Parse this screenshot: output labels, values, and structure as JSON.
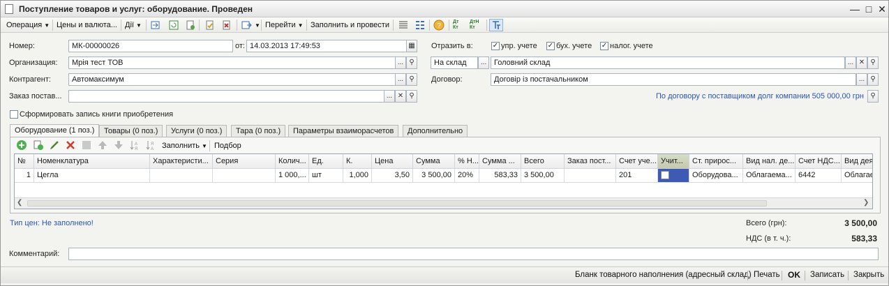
{
  "window": {
    "title": "Поступление товаров и услуг: оборудование. Проведен"
  },
  "toolbar": {
    "operation": "Операция",
    "prices": "Цены и валюта...",
    "actions": "Дії",
    "goto": "Перейти",
    "fill_post": "Заполнить и провести",
    "dt_kt": "Дт Кт",
    "dtn_kt": "ДтН Кт"
  },
  "header": {
    "number_label": "Номер:",
    "number_value": "МК-00000026",
    "date_label": "от:",
    "date_value": "14.03.2013 17:49:53",
    "reflect_label": "Отразить в:",
    "upr": "упр. учете",
    "buh": "бух. учете",
    "nalog": "налог. учете",
    "org_label": "Организация:",
    "org_value": "Мрія тест ТОВ",
    "warehouse_type": "На склад",
    "warehouse_value": "Головний склад",
    "contractor_label": "Контрагент:",
    "contractor_value": "Автомаксимум",
    "contract_label": "Договор:",
    "contract_value": "Договір із постачальником",
    "order_label": "Заказ постав...",
    "order_value": "",
    "debt_info": "По договору с поставщиком долг компании 505 000,00 грн",
    "purchase_book": "Сформировать запись книги приобретения"
  },
  "tabs": [
    "Оборудование (1 поз.)",
    "Товары (0 поз.)",
    "Услуги (0 поз.)",
    "Тара (0 поз.)",
    "Параметры взаиморасчетов",
    "Дополнительно"
  ],
  "table_toolbar": {
    "fill": "Заполнить",
    "select": "Подбор"
  },
  "table": {
    "columns": [
      "№",
      "Номенклатура",
      "Характеристи...",
      "Серия",
      "Колич...",
      "Ед.",
      "К.",
      "Цена",
      "Сумма",
      "% Н...",
      "Сумма ...",
      "Всего",
      "Заказ пост...",
      "Счет уче...",
      "Учит...",
      "Ст. прирос...",
      "Вид нал. де...",
      "Счет НДС...",
      "Вид дея"
    ],
    "rows": [
      [
        "1",
        "Цегла",
        "",
        "",
        "1 000,...",
        "шт",
        "1,000",
        "3,50",
        "3 500,00",
        "20%",
        "583,33",
        "3 500,00",
        "",
        "201",
        "",
        "Оборудова...",
        "Облагаема...",
        "6442",
        "Облагае"
      ]
    ]
  },
  "bottom": {
    "price_type": "Тип цен: Не заполнено!",
    "total_label": "Всего (грн):",
    "total_value": "3 500,00",
    "vat_label": "НДС (в т. ч.):",
    "vat_value": "583,33",
    "comment_label": "Комментарий:",
    "comment_value": ""
  },
  "footer": {
    "blank": "Бланк товарного наполнения (адресный склад)",
    "print": "Печать",
    "ok": "OK",
    "save": "Записать",
    "close": "Закрыть"
  }
}
